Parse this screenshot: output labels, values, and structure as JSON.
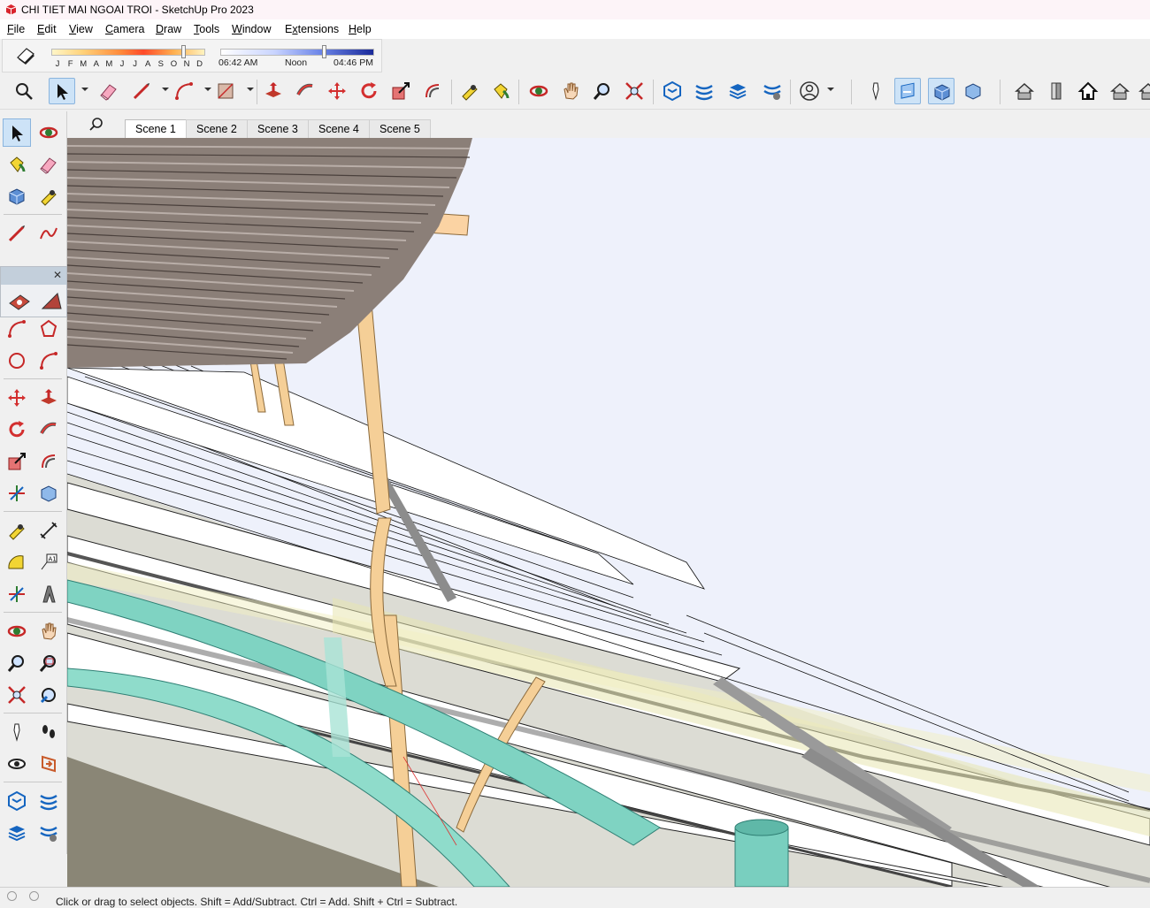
{
  "window": {
    "title": "CHI TIET MAI NGOAI TROI - SketchUp Pro 2023"
  },
  "menu": [
    {
      "label": "File",
      "mn": "F",
      "rest": "ile"
    },
    {
      "label": "Edit",
      "mn": "E",
      "rest": "dit"
    },
    {
      "label": "View",
      "mn": "V",
      "rest": "iew"
    },
    {
      "label": "Camera",
      "mn": "C",
      "rest": "amera"
    },
    {
      "label": "Draw",
      "mn": "D",
      "rest": "raw"
    },
    {
      "label": "Tools",
      "mn": "T",
      "rest": "ools"
    },
    {
      "label": "Window",
      "mn": "W",
      "rest": "indow"
    },
    {
      "label": "Extensions",
      "mn": "x",
      "pre": "E",
      "rest": "tensions"
    },
    {
      "label": "Help",
      "mn": "H",
      "rest": "elp"
    }
  ],
  "shadows": {
    "months": [
      "J",
      "F",
      "M",
      "A",
      "M",
      "J",
      "J",
      "A",
      "S",
      "O",
      "N",
      "D"
    ],
    "month_position": 0.86,
    "time_position": 0.68,
    "time_start": "06:42 AM",
    "time_mid": "Noon",
    "time_end": "04:46 PM"
  },
  "toolbar_icons": [
    "zoom-extents-icon",
    "select-icon",
    "eraser-icon",
    "line-icon",
    "arc-icon",
    "rectangle-icon",
    "push-pull-icon",
    "follow-me-icon",
    "move-icon",
    "rotate-icon",
    "scale-icon",
    "offset-icon",
    "tape-measure-icon",
    "paint-bucket-icon",
    "orbit-icon",
    "pan-icon",
    "zoom-icon",
    "zoom-window-icon",
    "warehouse-icon",
    "extension-warehouse-icon",
    "layer-icon",
    "sandbox-icon",
    "account-icon",
    "position-camera-icon",
    "section-plane-icon",
    "section-display-icon",
    "section-fill-icon",
    "iso-view-icon",
    "front-view-icon",
    "home-view-icon",
    "house-icon"
  ],
  "scenes": [
    "Scene 1",
    "Scene 2",
    "Scene 3",
    "Scene 4",
    "Scene 5"
  ],
  "active_scene": "Scene 1",
  "status": {
    "hint": "Click or drag to select objects. Shift = Add/Subtract. Ctrl = Add. Shift + Ctrl = Subtract."
  },
  "colors": {
    "accent": "#cde3f7",
    "sky": "#eef1fb",
    "timber": "#f5cf97",
    "pipe": "#7fd3c2"
  }
}
